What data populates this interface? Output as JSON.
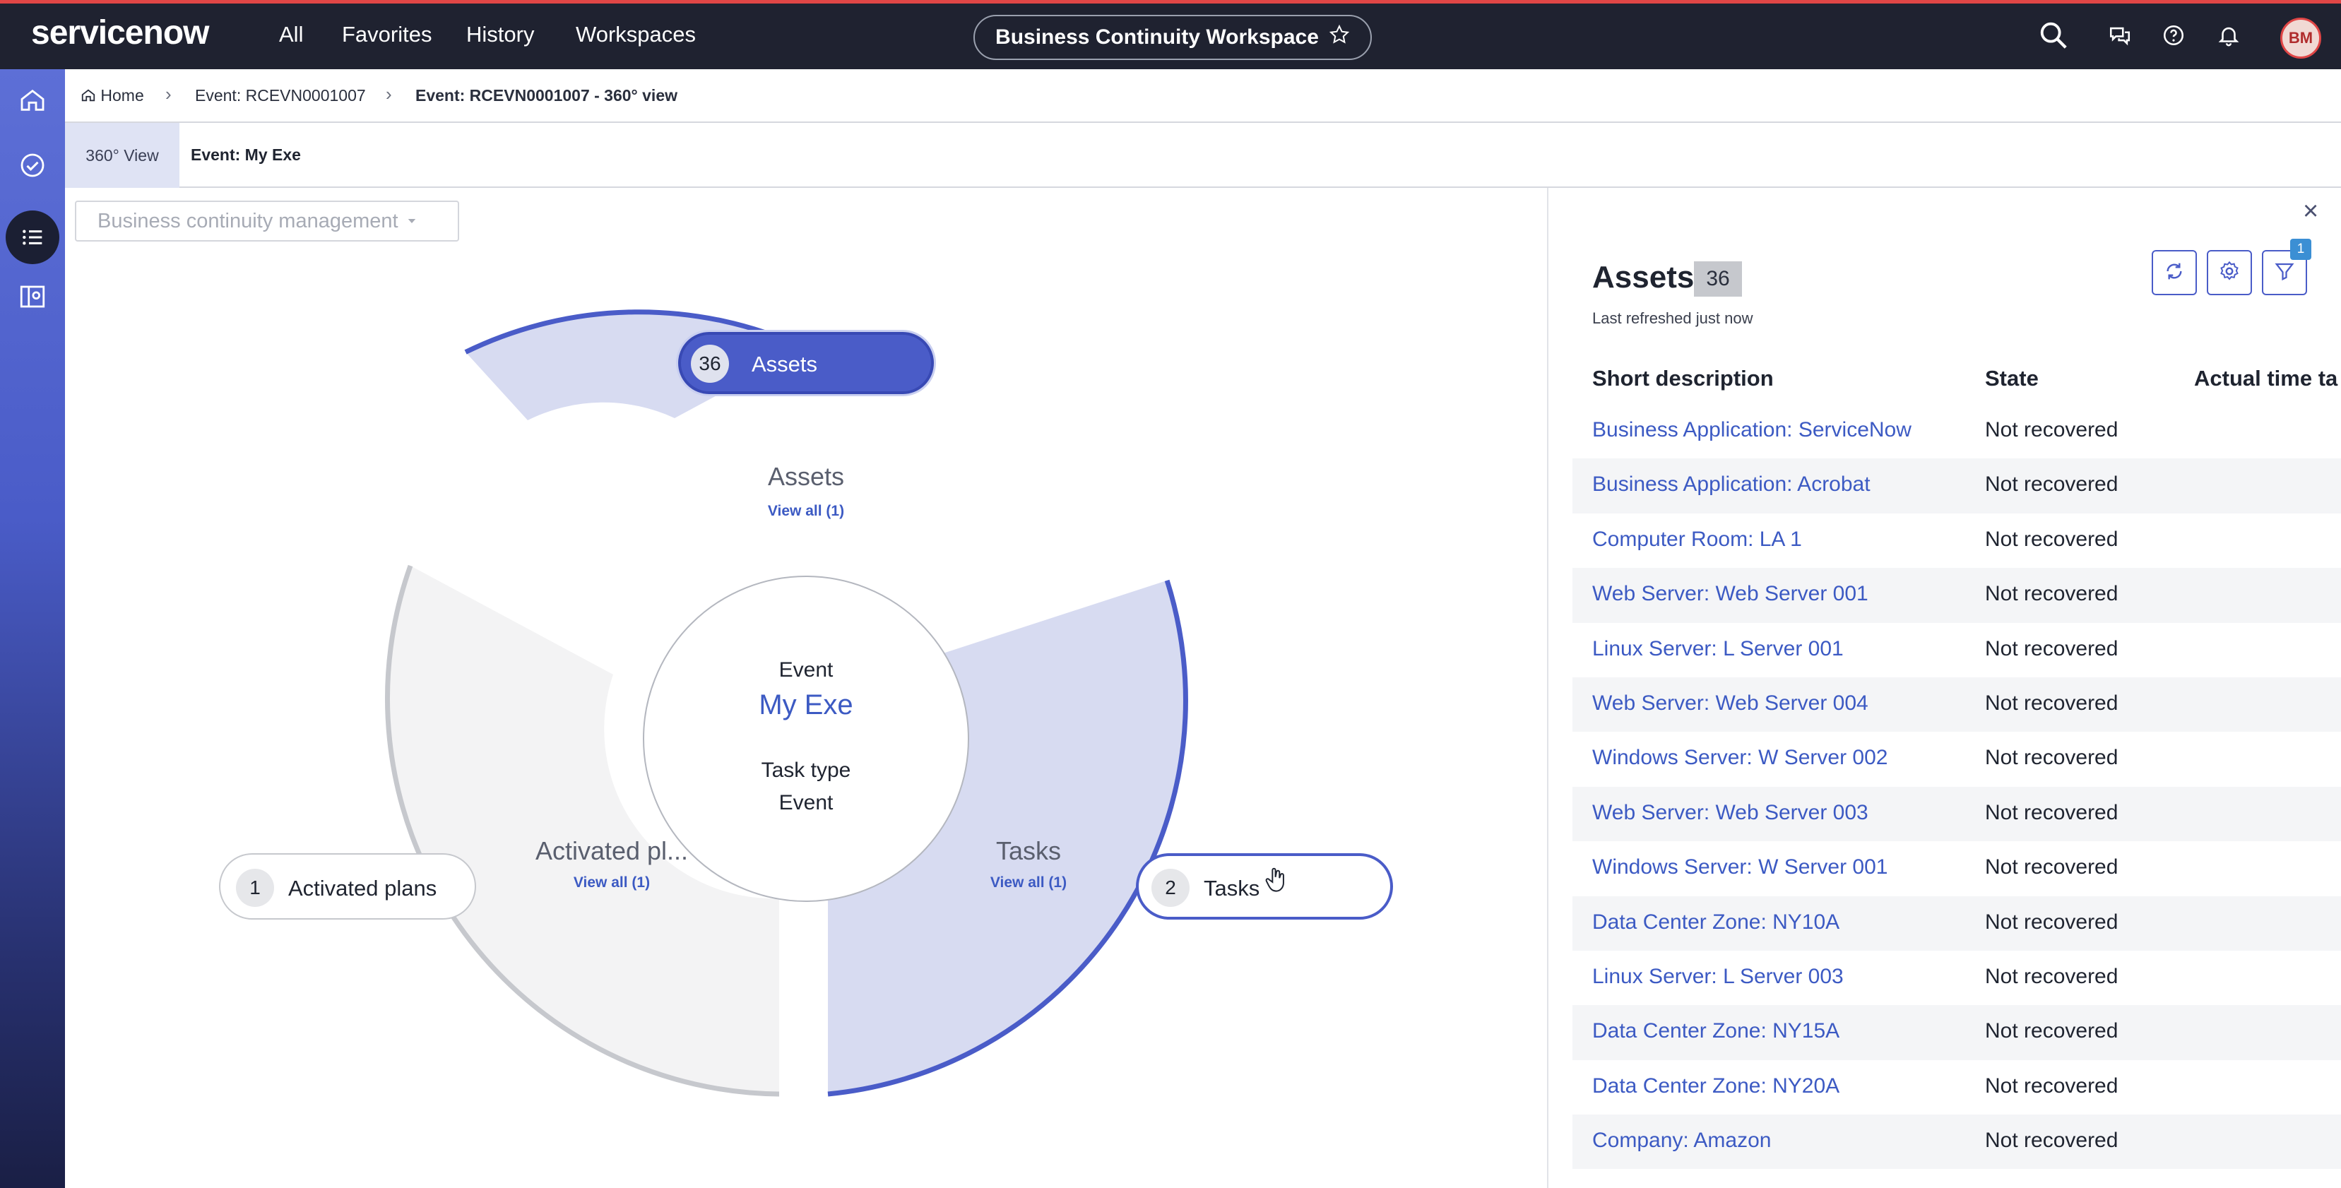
{
  "header": {
    "logo": "servicenow",
    "nav": [
      "All",
      "Favorites",
      "History",
      "Workspaces"
    ],
    "workspace_title": "Business Continuity Workspace",
    "avatar_initials": "BM",
    "icons": [
      "search-icon",
      "chat-icon",
      "help-icon",
      "bell-icon"
    ]
  },
  "rail": {
    "icons": [
      "home-icon",
      "checkmark-icon",
      "list-icon",
      "map-icon"
    ]
  },
  "breadcrumb": {
    "home": "Home",
    "item1": "Event: RCEVN0001007",
    "item2": "Event: RCEVN0001007 - 360° view"
  },
  "tabs": {
    "view": "360° View",
    "event": "Event: My Exe"
  },
  "main": {
    "select_value": "Business continuity management",
    "center": {
      "event_label": "Event",
      "event_name": "My Exe",
      "task_type_label": "Task type",
      "task_type_value": "Event"
    },
    "segments": {
      "assets": {
        "title": "Assets",
        "link": "View all (1)"
      },
      "plans": {
        "title": "Activated pl...",
        "link": "View all (1)"
      },
      "tasks": {
        "title": "Tasks",
        "link": "View all (1)"
      }
    },
    "pills": {
      "assets": {
        "count": "36",
        "label": "Assets"
      },
      "plans": {
        "count": "1",
        "label": "Activated plans"
      },
      "tasks": {
        "count": "2",
        "label": "Tasks"
      }
    },
    "colors": {
      "accent": "#4a5cc8",
      "segment_fill": "#d7dbf1",
      "inactive": "#f3f3f4"
    }
  },
  "panel": {
    "title": "Assets",
    "count": "36",
    "subtitle": "Last refreshed just now",
    "filter_badge": "1",
    "columns": [
      "Short description",
      "State",
      "Actual time ta"
    ],
    "rows": [
      {
        "desc": "Business Application: ServiceNow",
        "state": "Not recovered"
      },
      {
        "desc": "Business Application: Acrobat",
        "state": "Not recovered"
      },
      {
        "desc": "Computer Room: LA 1",
        "state": "Not recovered"
      },
      {
        "desc": "Web Server: Web Server 001",
        "state": "Not recovered"
      },
      {
        "desc": "Linux Server: L Server 001",
        "state": "Not recovered"
      },
      {
        "desc": "Web Server: Web Server 004",
        "state": "Not recovered"
      },
      {
        "desc": "Windows Server: W Server 002",
        "state": "Not recovered"
      },
      {
        "desc": "Web Server: Web Server 003",
        "state": "Not recovered"
      },
      {
        "desc": "Windows Server: W Server 001",
        "state": "Not recovered"
      },
      {
        "desc": "Data Center Zone: NY10A",
        "state": "Not recovered"
      },
      {
        "desc": "Linux Server: L Server 003",
        "state": "Not recovered"
      },
      {
        "desc": "Data Center Zone: NY15A",
        "state": "Not recovered"
      },
      {
        "desc": "Data Center Zone: NY20A",
        "state": "Not recovered"
      },
      {
        "desc": "Company: Amazon",
        "state": "Not recovered"
      }
    ]
  }
}
